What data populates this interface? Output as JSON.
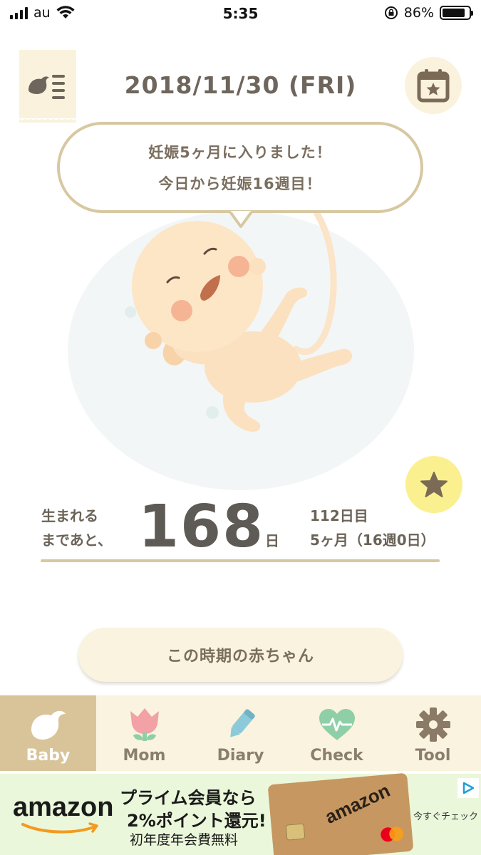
{
  "status_bar": {
    "carrier": "au",
    "time": "5:35",
    "battery": "86%",
    "battery_level": 0.86
  },
  "header": {
    "date": "2018/11/30 (FRI)",
    "menu_icon": "bird-list-icon",
    "calendar_icon": "calendar-star-icon"
  },
  "message": {
    "line1": "妊娠5ヶ月に入りました！",
    "line2": "今日から妊娠16週目！"
  },
  "countdown": {
    "label_line1": "生まれる",
    "label_line2": "まであと、",
    "days": "168",
    "unit": "日",
    "elapsed": "112日目",
    "term": "5ヶ月（16週0日）"
  },
  "main": {
    "baby_info_button": "この時期の赤ちゃん",
    "favorite_icon": "star-icon"
  },
  "tabs": [
    {
      "label": "Baby",
      "icon": "bird-icon",
      "active": true
    },
    {
      "label": "Mom",
      "icon": "tulip-icon",
      "active": false
    },
    {
      "label": "Diary",
      "icon": "pencil-icon",
      "active": false
    },
    {
      "label": "Check",
      "icon": "heart-pulse-icon",
      "active": false
    },
    {
      "label": "Tool",
      "icon": "gear-icon",
      "active": false
    }
  ],
  "ad": {
    "brand": "amazon",
    "line1": "プライム会員なら",
    "line2": "2%ポイント還元!",
    "line3": "初年度年会費無料",
    "card_brand": "amazon",
    "cta": "今すぐチェック"
  },
  "colors": {
    "accent": "#d9c49a",
    "bubble_border": "#d7c8a1",
    "tab_bar": "#faf3df",
    "star_button": "#fbf08f",
    "text": "#6b6358"
  }
}
